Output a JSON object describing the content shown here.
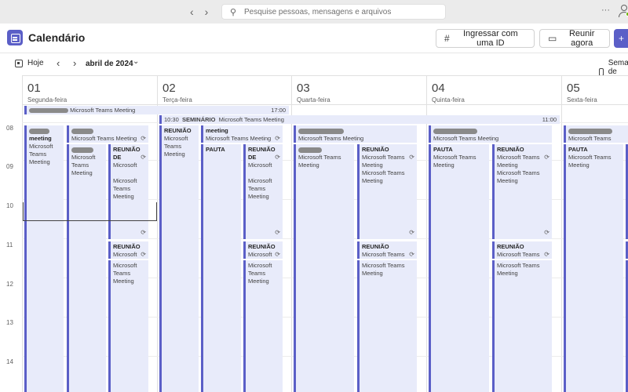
{
  "titlebar": {
    "search_placeholder": "Pesquise pessoas, mensagens e arquivos",
    "back_arrow": "‹",
    "forward_arrow": "›",
    "more": "···"
  },
  "header": {
    "title": "Calendário",
    "join_id_label": "Ingressar com uma ID",
    "meet_now_label": "Reunir agora",
    "new_label": "+"
  },
  "toolbar": {
    "today_label": "Hoje",
    "month_label": "abril de 2024",
    "view_label": "Semana de trabalho"
  },
  "days": [
    {
      "num": "01",
      "name": "Segunda-feira"
    },
    {
      "num": "02",
      "name": "Terça-feira"
    },
    {
      "num": "03",
      "name": "Quarta-feira"
    },
    {
      "num": "04",
      "name": "Quinta-feira"
    },
    {
      "num": "05",
      "name": "Sexta-feira"
    }
  ],
  "hours": [
    "08",
    "09",
    "10",
    "11",
    "12",
    "13",
    "14"
  ],
  "labels": {
    "teams": "Microsoft Teams Meeting",
    "teams_short": "Microsoft",
    "meeting": "meeting",
    "reuniao": "REUNIÃO",
    "reuniao_de": "REUNIÃO DE",
    "pauta": "PAUTA",
    "seminario": "SEMINÁRIO",
    "time_1030": "10:30",
    "time_1100": "11:00",
    "time_1700": "17:00",
    "teams_word": "Teams",
    "meeting_word": "Meeting",
    "rec": "⟳"
  },
  "colors": {
    "accent": "#5b5fc7",
    "event_bg": "#e8ebfa"
  }
}
